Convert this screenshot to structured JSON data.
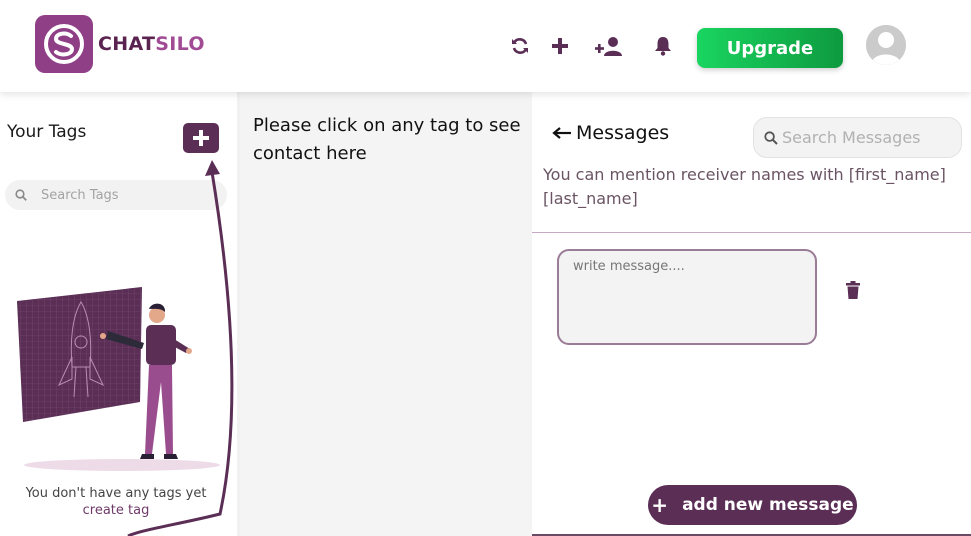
{
  "brand": {
    "part1": "CHAT",
    "part2": "SILO"
  },
  "header": {
    "icons": [
      "refresh-icon",
      "plus-icon",
      "add-user-icon",
      "bell-icon"
    ],
    "upgrade_label": "Upgrade"
  },
  "tags_panel": {
    "title": "Your Tags",
    "search_placeholder": "Search Tags",
    "empty_message": "You don't have any tags yet",
    "create_link": "create tag"
  },
  "contacts_panel": {
    "prompt": "Please click on any tag to see contact here"
  },
  "messages_panel": {
    "title": "Messages",
    "search_placeholder": "Search Messages",
    "mention_hint": "You can mention receiver names with [first_name] [last_name]",
    "message_placeholder": "write message....",
    "add_button_label": "add new message"
  },
  "colors": {
    "brand_purple": "#5b2e56",
    "upgrade_green": "#19d560"
  }
}
